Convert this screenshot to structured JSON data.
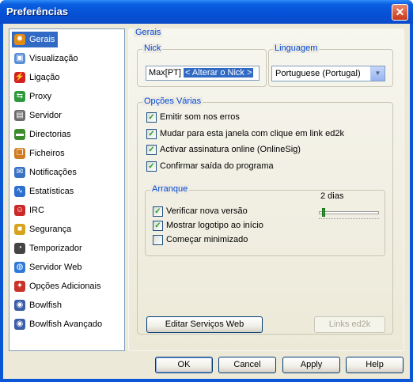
{
  "window": {
    "title": "Preferências",
    "close_label": "✕"
  },
  "sidebar": {
    "items": [
      {
        "label": "Gerais",
        "icon": "gear-icon",
        "color": "#e28c14",
        "glyph": "✹",
        "selected": true
      },
      {
        "label": "Visualização",
        "icon": "display-icon",
        "color": "#5a8fd8",
        "glyph": "▣"
      },
      {
        "label": "Ligação",
        "icon": "plug-icon",
        "color": "#d42020",
        "glyph": "⚡"
      },
      {
        "label": "Proxy",
        "icon": "proxy-icon",
        "color": "#2e9a3a",
        "glyph": "⇆"
      },
      {
        "label": "Servidor",
        "icon": "server-icon",
        "color": "#6d6d6d",
        "glyph": "▤"
      },
      {
        "label": "Directorias",
        "icon": "folder-icon",
        "color": "#3c8c2e",
        "glyph": "▬"
      },
      {
        "label": "Ficheiros",
        "icon": "files-icon",
        "color": "#d07c22",
        "glyph": "❐"
      },
      {
        "label": "Notificações",
        "icon": "notification-icon",
        "color": "#3a72c4",
        "glyph": "✉"
      },
      {
        "label": "Estatísticas",
        "icon": "statistics-icon",
        "color": "#2d6fcf",
        "glyph": "∿"
      },
      {
        "label": "IRC",
        "icon": "irc-icon",
        "color": "#cc2a2a",
        "glyph": "☺"
      },
      {
        "label": "Segurança",
        "icon": "lock-icon",
        "color": "#d8a31c",
        "glyph": "■"
      },
      {
        "label": "Temporizador",
        "icon": "clock-icon",
        "color": "#444444",
        "glyph": "◔"
      },
      {
        "label": "Servidor Web",
        "icon": "globe-icon",
        "color": "#2f7ad8",
        "glyph": "◍"
      },
      {
        "label": "Opções Adicionais",
        "icon": "extra-options-icon",
        "color": "#c8342a",
        "glyph": "✦"
      },
      {
        "label": "Bowlfish",
        "icon": "bowlfish-icon",
        "color": "#3b5ea8",
        "glyph": "◉"
      },
      {
        "label": "Bowlfish Avançado",
        "icon": "bowlfish-advanced-icon",
        "color": "#3b5ea8",
        "glyph": "◉"
      }
    ]
  },
  "panel": {
    "title": "Gerais",
    "nick": {
      "legend": "Nick",
      "value": "Max[PT]",
      "selected_text": "< Alterar o Nick >"
    },
    "language": {
      "legend": "Linguagem",
      "value": "Portuguese (Portugal)"
    },
    "options": {
      "legend": "Opções Várias",
      "items": [
        {
          "label": "Emitir som nos erros",
          "checked": true
        },
        {
          "label": "Mudar para esta janela com clique em link ed2k",
          "checked": true
        },
        {
          "label": "Activar assinatura online (OnlineSig)",
          "checked": true
        },
        {
          "label": "Confirmar saída do programa",
          "checked": true
        }
      ]
    },
    "startup": {
      "legend": "Arranque",
      "items": [
        {
          "label": "Verificar nova versão",
          "checked": true
        },
        {
          "label": "Mostrar logotipo ao início",
          "checked": true
        },
        {
          "label": "Começar minimizado",
          "checked": false
        }
      ],
      "interval_label": "2 dias",
      "interval_level": 0.03
    },
    "buttons": {
      "web_services": "Editar Serviços Web",
      "ed2k_links": "Links ed2k"
    }
  },
  "footer": {
    "ok": "OK",
    "cancel": "Cancel",
    "apply": "Apply",
    "help": "Help"
  }
}
